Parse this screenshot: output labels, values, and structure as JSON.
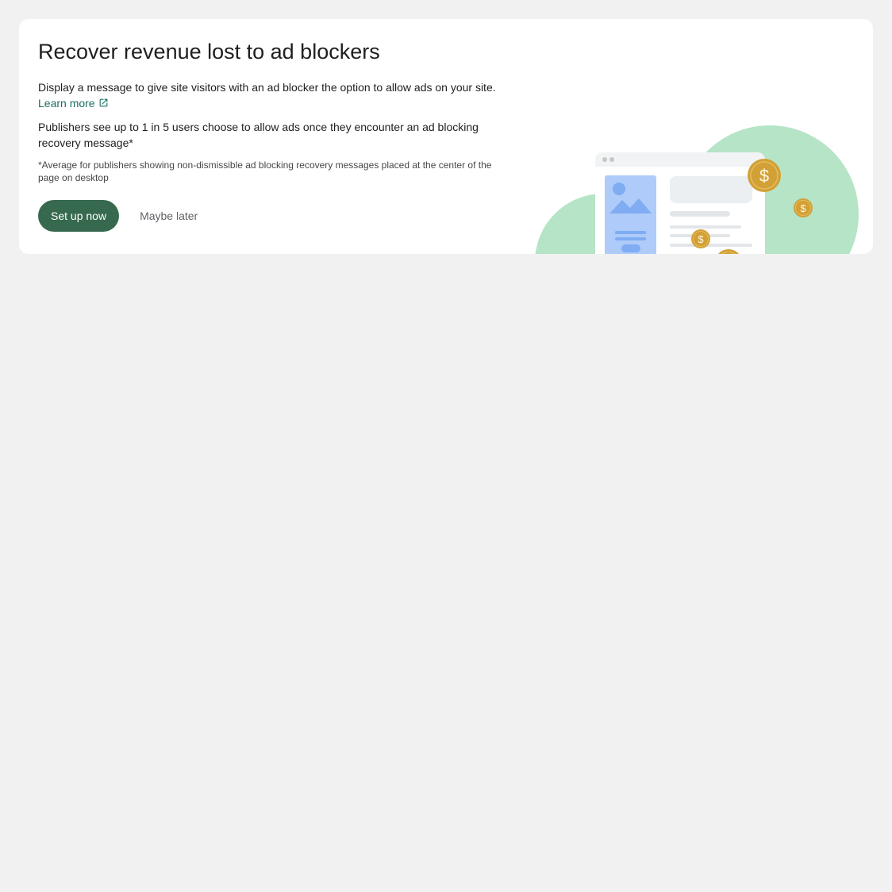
{
  "card": {
    "title": "Recover revenue lost to ad blockers",
    "description": "Display a message to give site visitors with an ad blocker the option to allow ads on your site.",
    "learn_more": "Learn more",
    "stat": "Publishers see up to 1 in 5 users choose to allow ads once they encounter an ad blocking recovery message*",
    "footnote": "*Average for publishers showing non-dismissible ad blocking recovery messages placed at the center of the page on desktop",
    "primary_button": "Set up now",
    "secondary_button": "Maybe later"
  },
  "illustration": {
    "coin_symbol": "$",
    "icons": [
      "browser-window-icon",
      "image-placeholder-icon",
      "dollar-coin-icon",
      "open-in-new-icon"
    ]
  },
  "colors": {
    "page_background": "#f1f1f1",
    "card_background": "#ffffff",
    "primary_button": "#37694f",
    "link": "#1a6e5f",
    "blob": "#b6e4c6",
    "coin": "#d2a036",
    "placeholder_blue": "#aecbfa"
  }
}
